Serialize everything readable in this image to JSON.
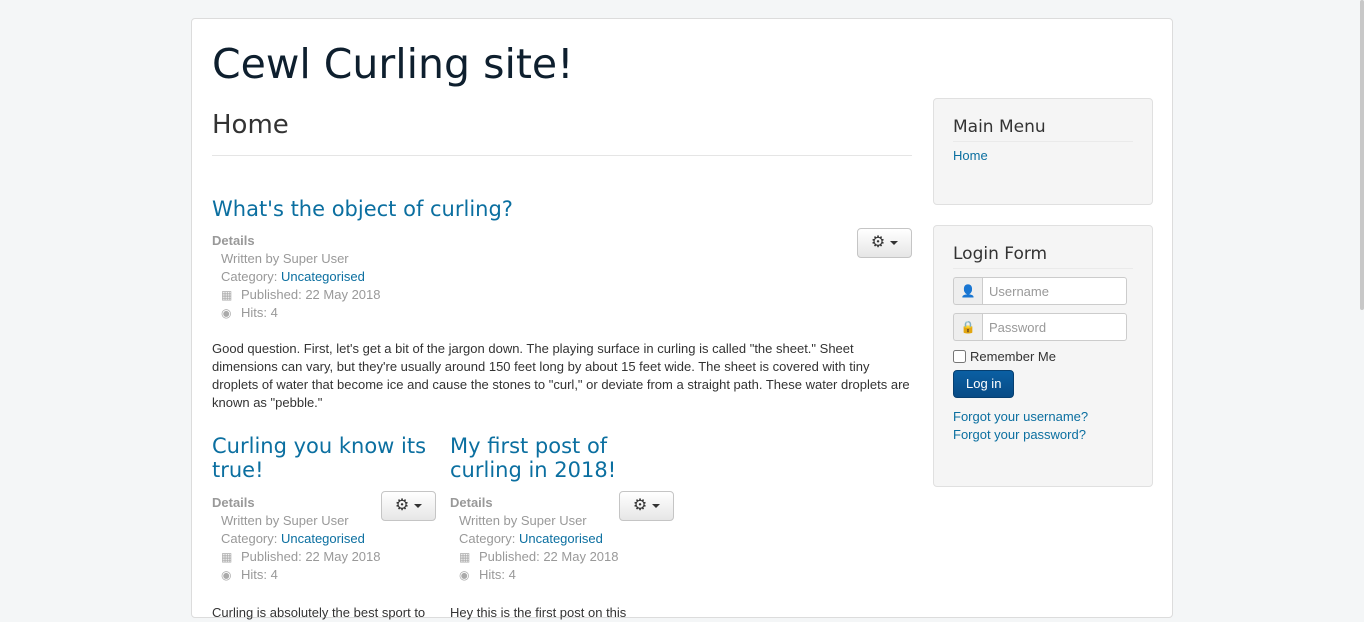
{
  "site": {
    "title": "Cewl Curling site!"
  },
  "main": {
    "heading": "Home",
    "lead": {
      "title": "What's the object of curling?",
      "details_label": "Details",
      "author": "Written by Super User",
      "category_prefix": "Category: ",
      "category": "Uncategorised",
      "published": "Published: 22 May 2018",
      "hits": "Hits: 4",
      "body": "Good question. First, let's get a bit of the jargon down. The playing surface in curling is called \"the sheet.\" Sheet dimensions can vary, but they're usually around 150 feet long by about 15 feet wide. The sheet is covered with tiny droplets of water that become ice and cause the stones to \"curl,\" or deviate from a straight path. These water droplets are known as \"pebble.\""
    },
    "articles": [
      {
        "title": "Curling you know its true!",
        "details_label": "Details",
        "author": "Written by Super User",
        "category_prefix": "Category: ",
        "category": "Uncategorised",
        "published": "Published: 22 May 2018",
        "hits": "Hits: 4",
        "body": "Curling is absolutely the best sport to"
      },
      {
        "title": "My first post of curling in 2018!",
        "details_label": "Details",
        "author": "Written by Super User",
        "category_prefix": "Category: ",
        "category": "Uncategorised",
        "published": "Published: 22 May 2018",
        "hits": "Hits: 4",
        "body": "Hey this is the first post on this"
      }
    ]
  },
  "sidebar": {
    "main_menu": {
      "title": "Main Menu",
      "items": [
        {
          "label": "Home"
        }
      ]
    },
    "login_form": {
      "title": "Login Form",
      "username_placeholder": "Username",
      "password_placeholder": "Password",
      "remember_label": "Remember Me",
      "login_button": "Log in",
      "forgot_username": "Forgot your username?",
      "forgot_password": "Forgot your password?"
    }
  },
  "icons": {
    "gear": "gear-icon",
    "calendar": "calendar-icon",
    "eye": "eye-icon",
    "user": "user-icon",
    "lock": "lock-icon"
  },
  "colors": {
    "link": "#0b6fa0",
    "button": "#0a5fa3",
    "title": "#0e1f2e"
  }
}
